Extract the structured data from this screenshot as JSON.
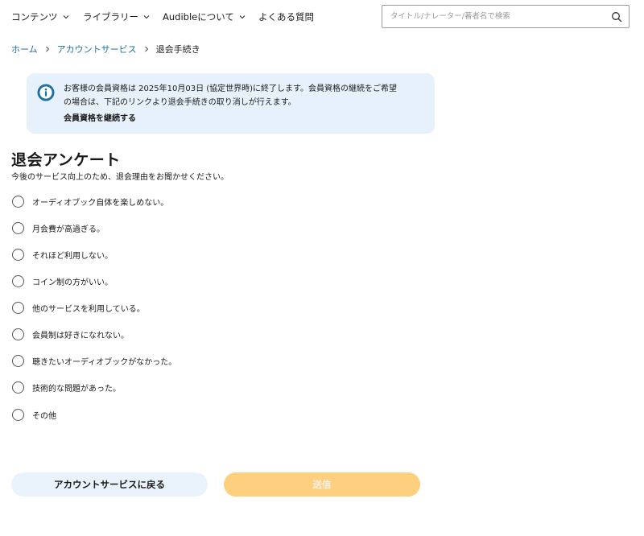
{
  "nav": {
    "items": [
      {
        "label": "コンテンツ"
      },
      {
        "label": "ライブラリー"
      },
      {
        "label": "Audibleについて"
      },
      {
        "label": "よくある質問"
      }
    ],
    "search_placeholder": "タイトル/ナレーター/著者名で検索"
  },
  "breadcrumb": {
    "home": "ホーム",
    "account": "アカウントサービス",
    "current": "退会手続き"
  },
  "notice": {
    "line1": "お客様の会員資格は 2025年10月03日 (協定世界時)に終了します。会員資格の継続をご希望",
    "line2": "の場合は、下記のリンクより退会手続きの取り消しが行えます。",
    "link": "会員資格を継続する"
  },
  "survey": {
    "title": "退会アンケート",
    "subtitle": "今後のサービス向上のため、退会理由をお聞かせください。",
    "options": [
      "オーディオブック自体を楽しめない。",
      "月会費が高過ぎる。",
      "それほど利用しない。",
      "コイン制の方がいい。",
      "他のサービスを利用している。",
      "会員制は好きになれない。",
      "聴きたいオーディオブックがなかった。",
      "技術的な問題があった。",
      "その他"
    ]
  },
  "buttons": {
    "back": "アカウントサービスに戻る",
    "submit": "送信"
  },
  "colors": {
    "link": "#1f6f9c",
    "notice_bg": "#e6f1fc",
    "info_icon": "#1f6f9c",
    "submit_bg": "#ffcf80",
    "back_bg": "#eaf2fb"
  }
}
